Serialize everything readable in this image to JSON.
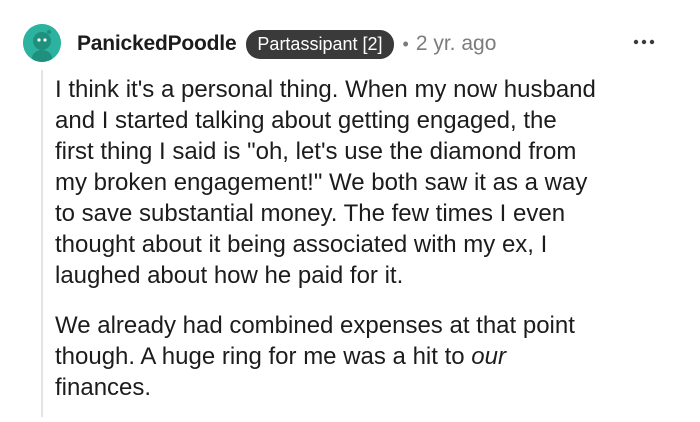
{
  "comment": {
    "author": "PanickedPoodle",
    "flair": "Partassipant [2]",
    "separator": "•",
    "time_ago": "2 yr. ago",
    "avatar_icon": "snoo-avatar-icon",
    "more_icon": "more-options-icon",
    "accent_color": "#2bb39f",
    "paragraph1": [
      "I think it's a personal thing. When my now husband",
      "and I started talking about getting engaged, the",
      "first thing I said is \"oh, let's use the diamond from",
      "my broken engagement!\" We both saw it as a way",
      "to save substantial money. The few times I even",
      "thought about it being associated with my ex, I",
      "laughed about how he paid for it."
    ],
    "paragraph2": {
      "line1": "We already had combined expenses at that point",
      "line2_before": "though. A huge ring for me was a hit to ",
      "line2_italic": "our",
      "line3": "finances."
    }
  }
}
